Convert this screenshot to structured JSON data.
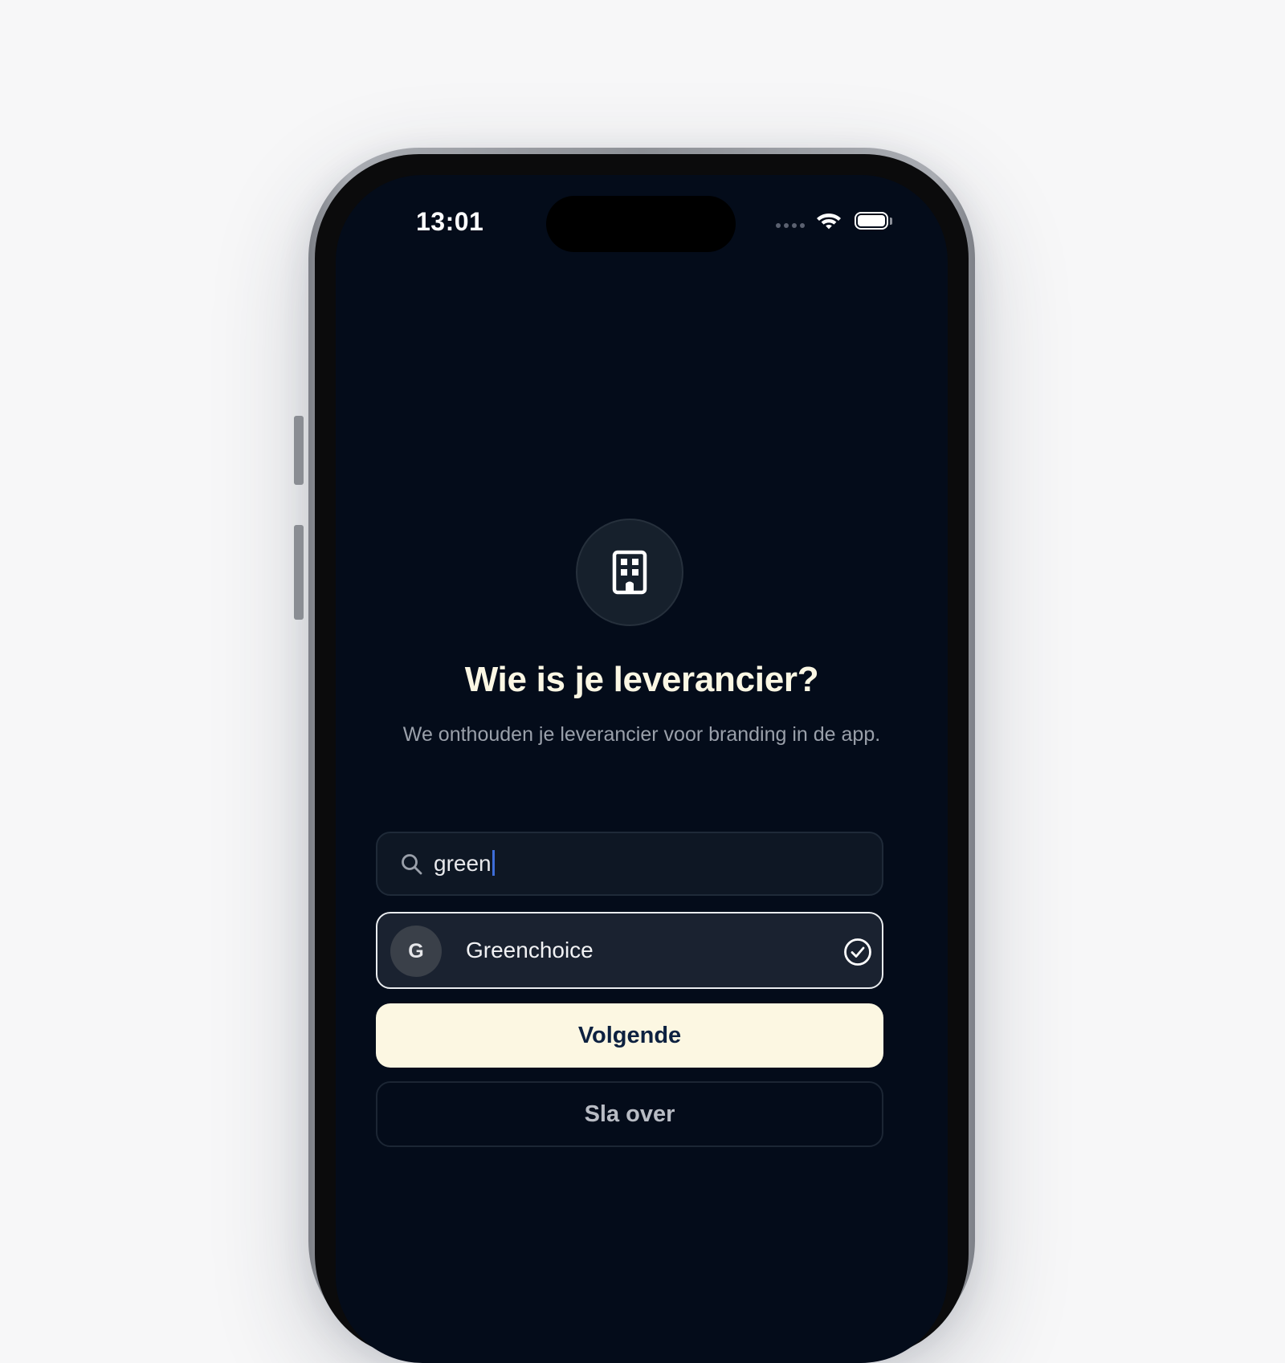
{
  "status_bar": {
    "time": "13:01",
    "icons": [
      "signal-icon",
      "wifi-icon",
      "battery-icon"
    ]
  },
  "screen": {
    "hero_icon": "building-icon",
    "title": "Wie is je leverancier?",
    "subtitle": "We onthouden je leverancier voor branding in de app."
  },
  "search": {
    "icon": "search-icon",
    "value": "green"
  },
  "results": [
    {
      "initial": "G",
      "name": "Greenchoice",
      "selected": true,
      "icon": "check-circle-icon"
    }
  ],
  "buttons": {
    "primary_label": "Volgende",
    "secondary_label": "Sla over"
  },
  "colors": {
    "background": "#040c1a",
    "title": "#fbf7e4",
    "primary_button": "#fcf7e2",
    "primary_text": "#0d2140",
    "caret": "#3d6dd8"
  }
}
